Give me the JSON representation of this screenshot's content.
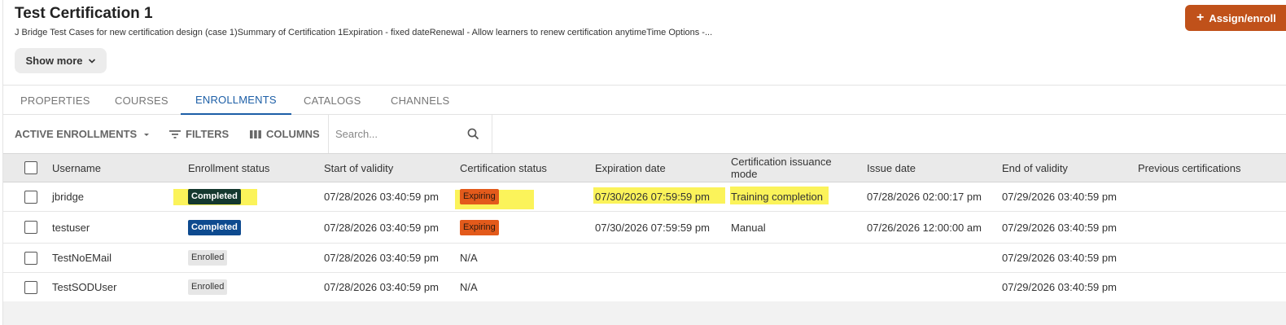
{
  "header": {
    "title": "Test Certification 1",
    "description": "J Bridge Test Cases for new certification design (case 1)Summary of Certification 1Expiration - fixed dateRenewal - Allow learners to renew certification anytimeTime Options -...",
    "show_more_label": "Show more",
    "assign_label": "Assign/enroll"
  },
  "tabs": [
    {
      "label": "PROPERTIES",
      "active": false
    },
    {
      "label": "COURSES",
      "active": false
    },
    {
      "label": "ENROLLMENTS",
      "active": true
    },
    {
      "label": "CATALOGS",
      "active": false
    },
    {
      "label": "CHANNELS",
      "active": false
    }
  ],
  "toolbar": {
    "view_label": "ACTIVE ENROLLMENTS",
    "filters_label": "FILTERS",
    "columns_label": "COLUMNS",
    "search_placeholder": "Search..."
  },
  "table": {
    "columns": [
      "Username",
      "Enrollment status",
      "Start of validity",
      "Certification status",
      "Expiration date",
      "Certification issuance mode",
      "Issue date",
      "End of validity",
      "Previous certifications"
    ],
    "rows": [
      {
        "username": "jbridge",
        "enrollment_status": "Completed",
        "start_of_validity": "07/28/2026 03:40:59 pm",
        "certification_status": "Expiring",
        "expiration_date": "07/30/2026 07:59:59 pm",
        "issuance_mode": "Training completion",
        "issue_date": "07/28/2026 02:00:17 pm",
        "end_of_validity": "07/29/2026 03:40:59 pm",
        "previous_certifications": ""
      },
      {
        "username": "testuser",
        "enrollment_status": "Completed",
        "start_of_validity": "07/28/2026 03:40:59 pm",
        "certification_status": "Expiring",
        "expiration_date": "07/30/2026 07:59:59 pm",
        "issuance_mode": "Manual",
        "issue_date": "07/26/2026 12:00:00 am",
        "end_of_validity": "07/29/2026 03:40:59 pm",
        "previous_certifications": ""
      },
      {
        "username": "TestNoEMail",
        "enrollment_status": "Enrolled",
        "start_of_validity": "07/28/2026 03:40:59 pm",
        "certification_status": "N/A",
        "expiration_date": "",
        "issuance_mode": "",
        "issue_date": "",
        "end_of_validity": "07/29/2026 03:40:59 pm",
        "previous_certifications": ""
      },
      {
        "username": "TestSODUser",
        "enrollment_status": "Enrolled",
        "start_of_validity": "07/28/2026 03:40:59 pm",
        "certification_status": "N/A",
        "expiration_date": "",
        "issuance_mode": "",
        "issue_date": "",
        "end_of_validity": "07/29/2026 03:40:59 pm",
        "previous_certifications": ""
      }
    ]
  },
  "colors": {
    "accent": "#1d5fa7",
    "assign_button": "#c0511a",
    "completed_badge": "#0d4a8f",
    "expiring_badge": "#e35a1b",
    "highlight": "#fbf35a"
  }
}
